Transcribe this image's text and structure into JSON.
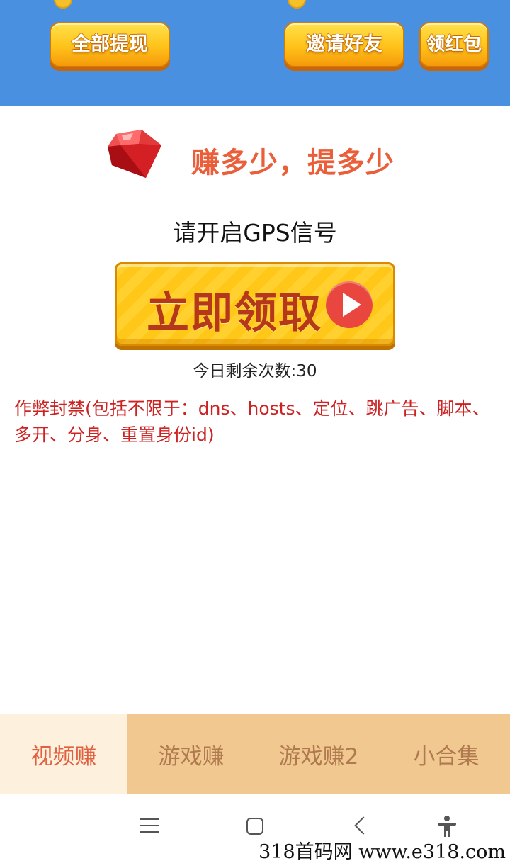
{
  "header": {
    "withdraw_all": "全部提现",
    "invite_friends": "邀请好友",
    "red_packet": "领红包"
  },
  "promo": {
    "slogan": "赚多少，提多少",
    "gps_notice": "请开启GPS信号",
    "claim_label": "立即领取",
    "remaining": "今日剩余次数:30",
    "warning": "作弊封禁(包括不限于：dns、hosts、定位、跳广告、脚本、多开、分身、重置身份id)"
  },
  "tabs": [
    {
      "label": "视频赚",
      "active": true
    },
    {
      "label": "游戏赚",
      "active": false
    },
    {
      "label": "游戏赚2",
      "active": false
    },
    {
      "label": "小合集",
      "active": false
    }
  ],
  "colors": {
    "header_bg": "#4a90e0",
    "accent_orange": "#ea5f3a",
    "warning_red": "#cc2222",
    "tab_bar": "#f0c890",
    "tab_active": "#fdf0dc"
  },
  "icons": [
    "coin-icon",
    "ruby-icon",
    "play-icon",
    "menu-icon",
    "home-icon",
    "back-icon",
    "accessibility-icon"
  ],
  "watermark": "318首码网 www.e318.com"
}
